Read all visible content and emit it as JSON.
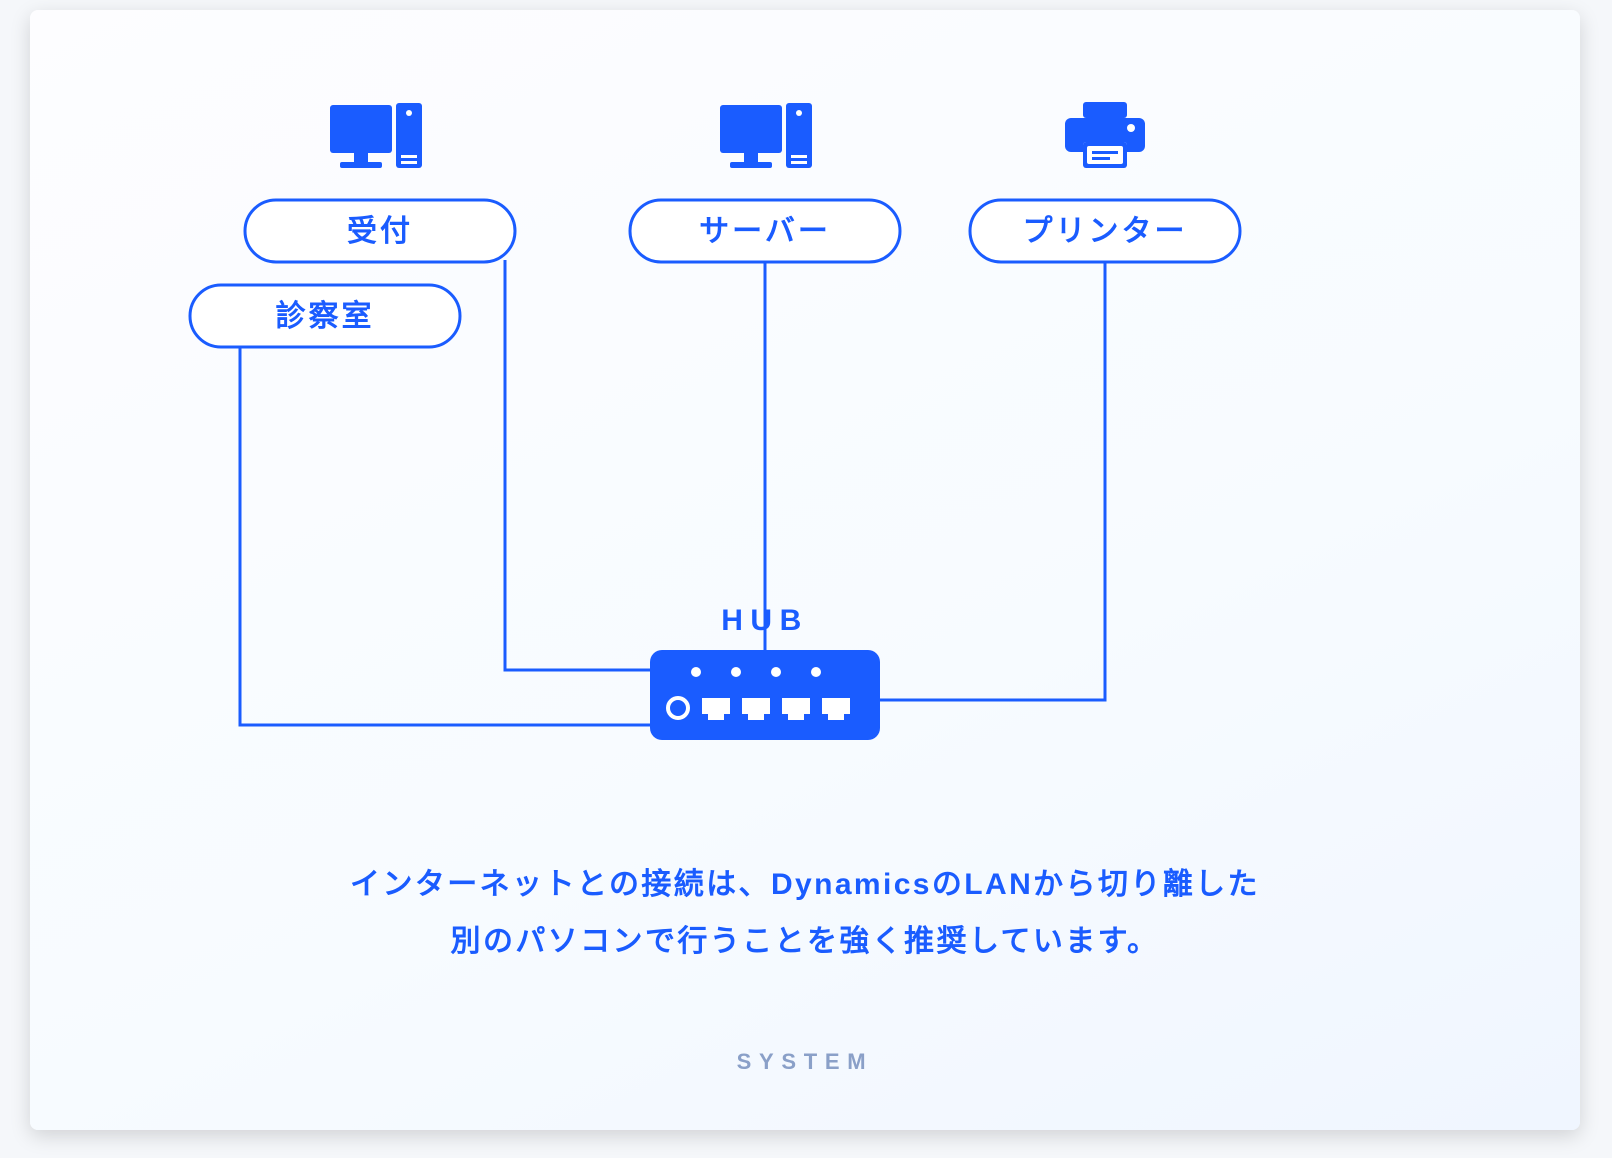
{
  "nodes": {
    "reception": {
      "label": "受付"
    },
    "exam_room": {
      "label": "診察室"
    },
    "server": {
      "label": "サーバー"
    },
    "printer": {
      "label": "プリンター"
    }
  },
  "hub": {
    "label": "HUB"
  },
  "footer": {
    "line1": "インターネットとの接続は、DynamicsのLANから切り離した",
    "line2": "別のパソコンで行うことを強く推奨しています。"
  },
  "tag": "SYSTEM",
  "colors": {
    "accent": "#1a5cff"
  }
}
